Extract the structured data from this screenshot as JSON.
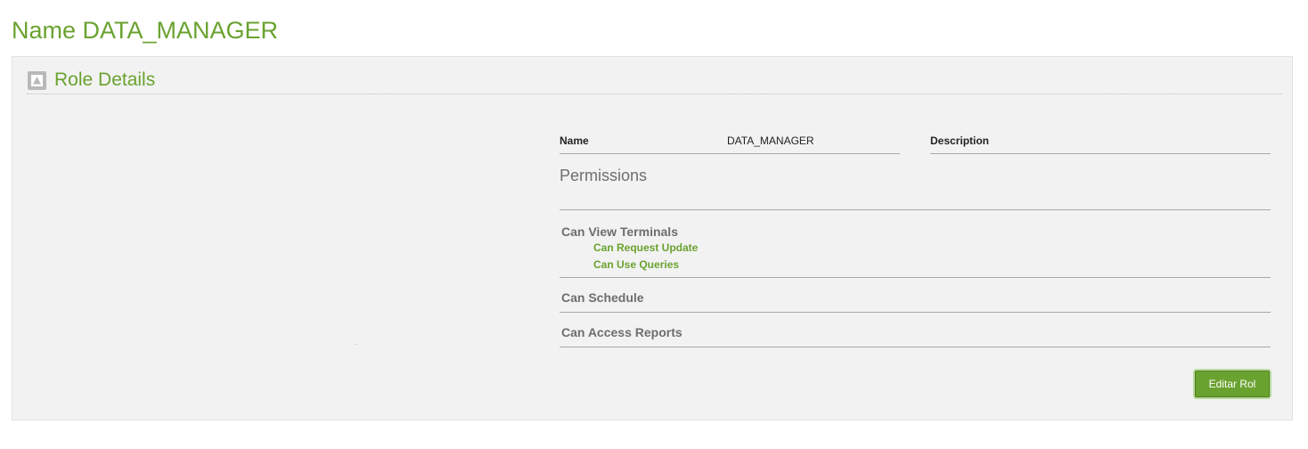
{
  "page": {
    "title": "Name DATA_MANAGER"
  },
  "panel": {
    "title": "Role Details",
    "toggle_icon": "collapse-up-icon"
  },
  "details": {
    "name_label": "Name",
    "name_value": "DATA_MANAGER",
    "description_label": "Description",
    "description_value": ""
  },
  "permissions": {
    "title": "Permissions",
    "groups": [
      {
        "label": "Can View Terminals",
        "children": [
          "Can Request Update",
          "Can Use Queries"
        ]
      },
      {
        "label": "Can Schedule",
        "children": []
      },
      {
        "label": "Can Access Reports",
        "children": []
      }
    ]
  },
  "actions": {
    "edit_label": "Editar Rol"
  },
  "colors": {
    "accent": "#6aa22f",
    "panel_bg": "#f2f2f2",
    "muted_text": "#6e6e6e"
  }
}
